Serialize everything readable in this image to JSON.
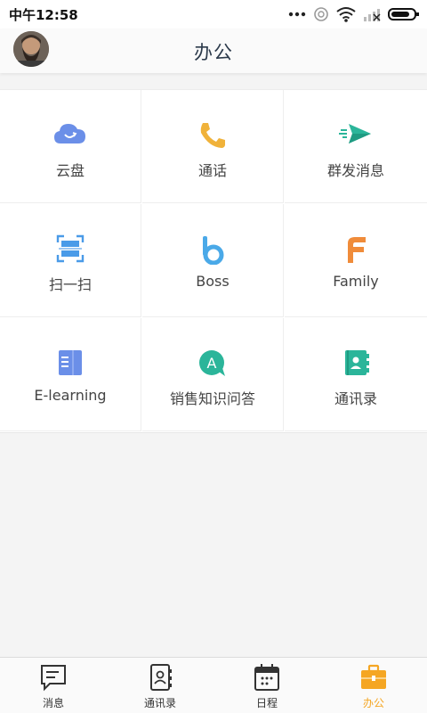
{
  "status_bar": {
    "time": "中午12:58",
    "icons": [
      "more-dots-icon",
      "alarm-icon",
      "wifi-icon",
      "signal-icon",
      "battery-icon"
    ]
  },
  "header": {
    "title": "办公",
    "avatar_icon": "user-avatar"
  },
  "apps": [
    {
      "label": "云盘",
      "icon": "cloud-icon",
      "color": "#6b8fe8"
    },
    {
      "label": "通话",
      "icon": "phone-icon",
      "color": "#f0b23a"
    },
    {
      "label": "群发消息",
      "icon": "send-icon",
      "color": "#2bb59a"
    },
    {
      "label": "扫一扫",
      "icon": "scan-icon",
      "color": "#4a9be8"
    },
    {
      "label": "Boss",
      "icon": "boss-b-icon",
      "color": "#4aa9e8"
    },
    {
      "label": "Family",
      "icon": "family-f-icon",
      "color": "#f08c3a"
    },
    {
      "label": "E-learning",
      "icon": "book-icon",
      "color": "#6b8fe8"
    },
    {
      "label": "销售知识问答",
      "icon": "qa-bubble-icon",
      "color": "#2bb59a"
    },
    {
      "label": "通讯录",
      "icon": "contacts-book-icon",
      "color": "#2bb59a"
    }
  ],
  "tabs": [
    {
      "label": "消息",
      "icon": "message-icon"
    },
    {
      "label": "通讯录",
      "icon": "contacts-icon"
    },
    {
      "label": "日程",
      "icon": "calendar-icon"
    },
    {
      "label": "办公",
      "icon": "briefcase-icon",
      "active": true
    }
  ],
  "colors": {
    "accent": "#f5a623",
    "title": "#2c3a4b"
  }
}
